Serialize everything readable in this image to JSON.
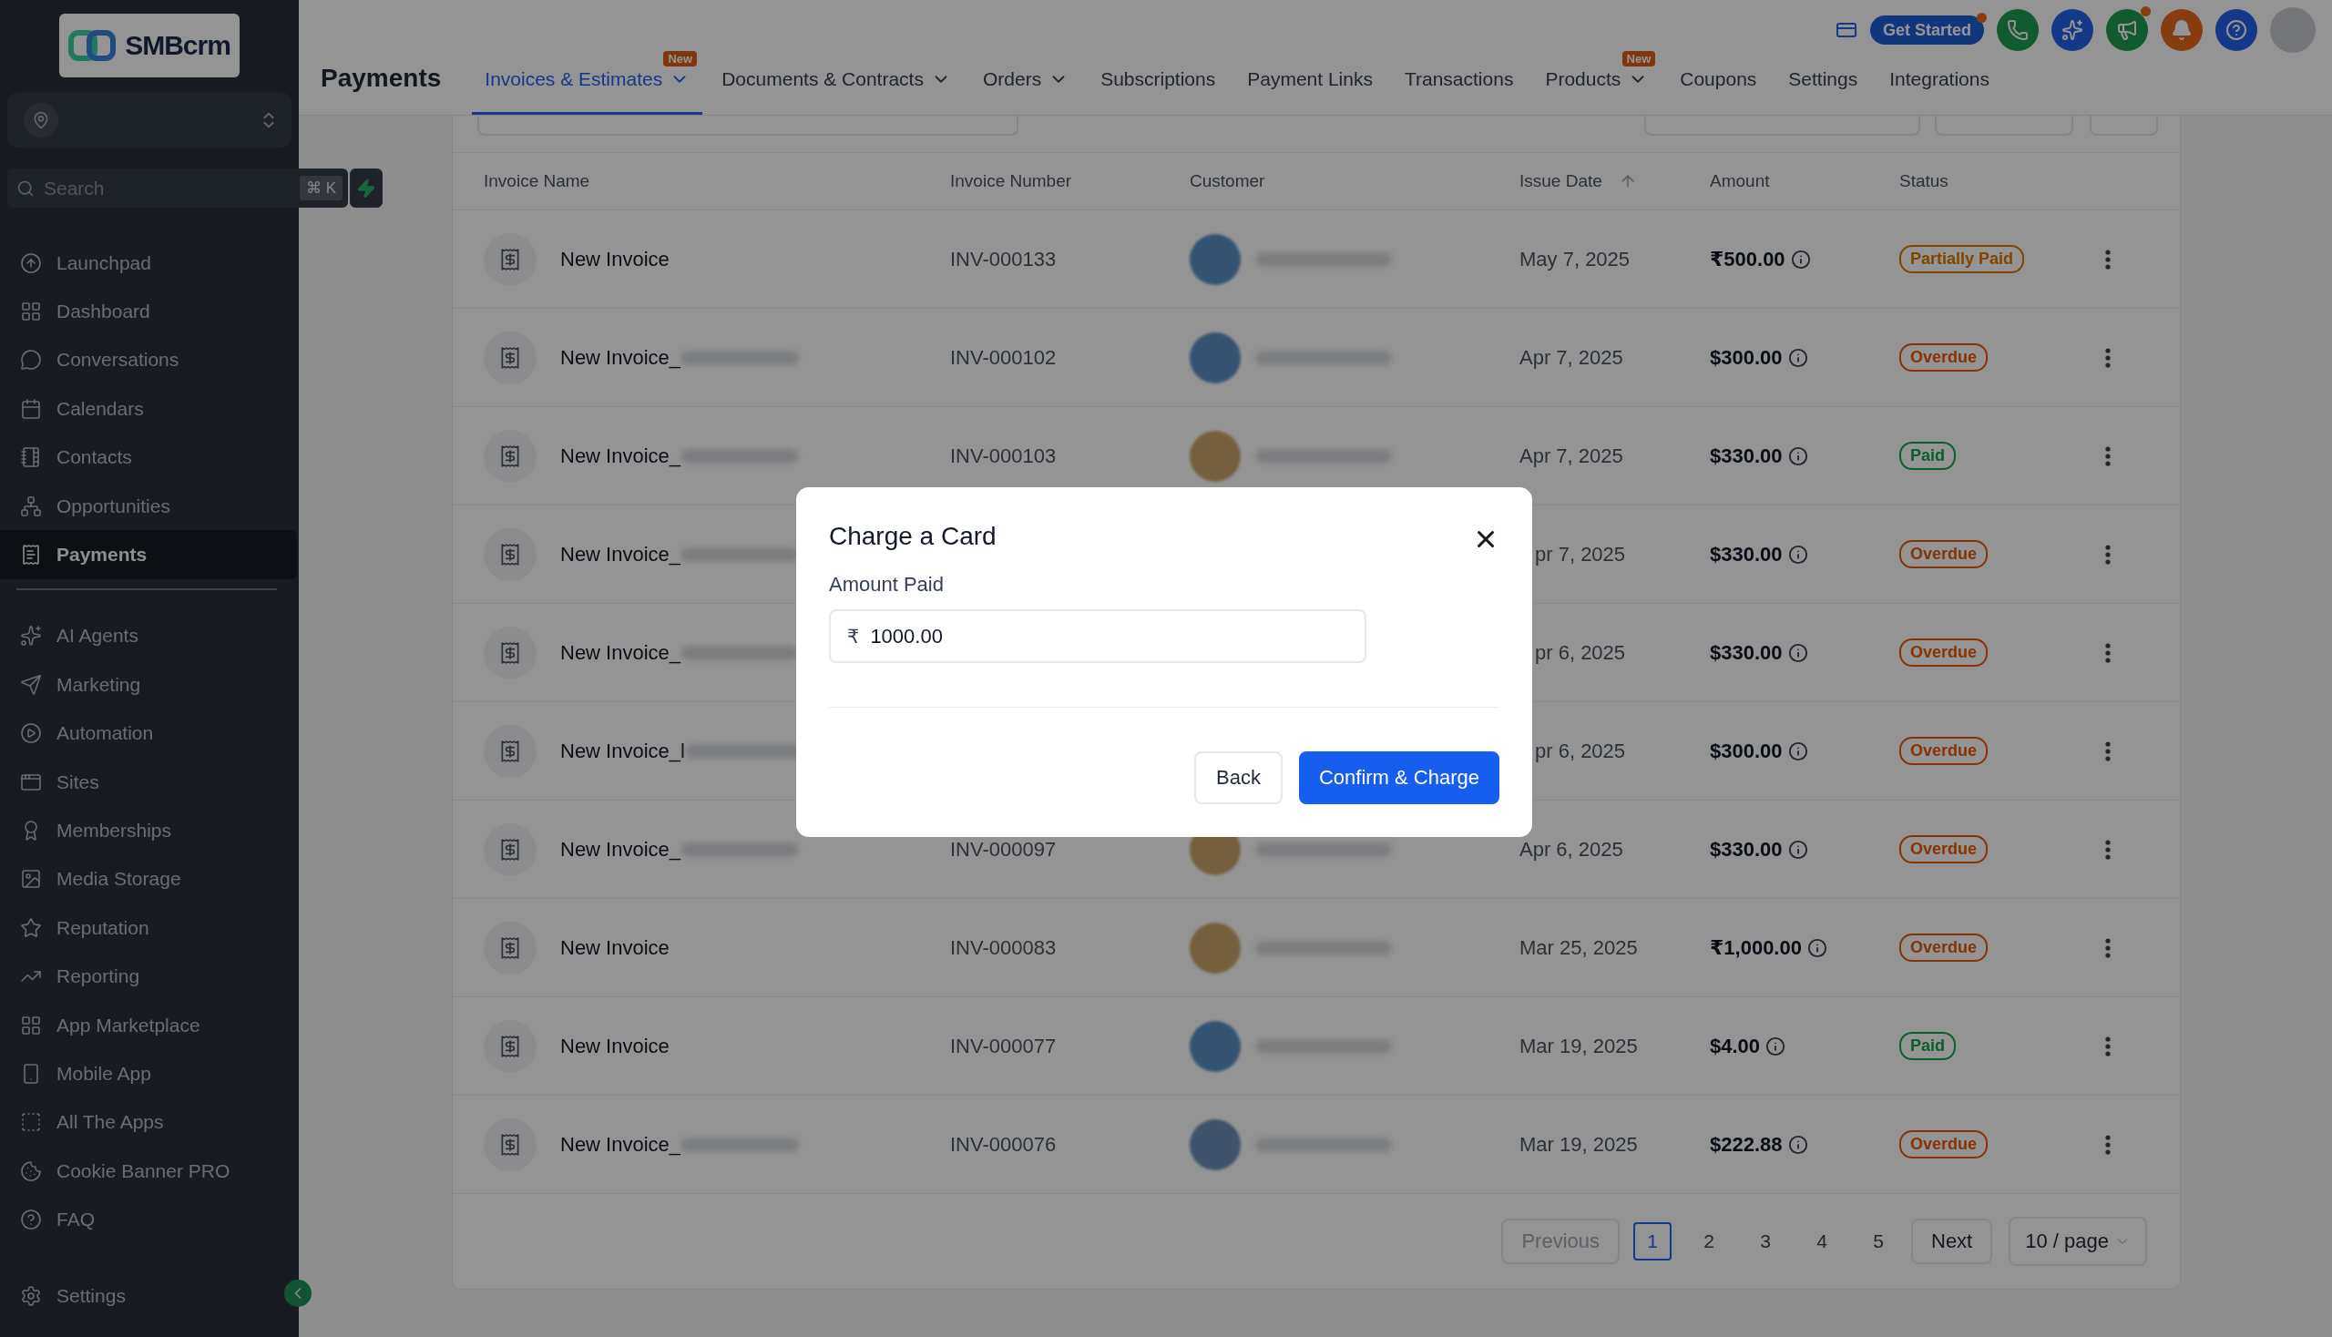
{
  "sidebar": {
    "logo": {
      "text": "SMBcrm"
    },
    "search": {
      "placeholder": "Search",
      "shortcut": "⌘ K"
    },
    "main_items": [
      {
        "label": "Launchpad",
        "selected": false
      },
      {
        "label": "Dashboard",
        "selected": false
      },
      {
        "label": "Conversations",
        "selected": false
      },
      {
        "label": "Calendars",
        "selected": false
      },
      {
        "label": "Contacts",
        "selected": false
      },
      {
        "label": "Opportunities",
        "selected": false
      },
      {
        "label": "Payments",
        "selected": true
      }
    ],
    "more_items": [
      {
        "label": "AI Agents",
        "selected": false
      },
      {
        "label": "Marketing",
        "selected": false
      },
      {
        "label": "Automation",
        "selected": false
      },
      {
        "label": "Sites",
        "selected": false
      },
      {
        "label": "Memberships",
        "selected": false
      },
      {
        "label": "Media Storage",
        "selected": false
      },
      {
        "label": "Reputation",
        "selected": false
      },
      {
        "label": "Reporting",
        "selected": false
      },
      {
        "label": "App Marketplace",
        "selected": false
      },
      {
        "label": "Mobile App",
        "selected": false
      },
      {
        "label": "All The Apps",
        "selected": false
      },
      {
        "label": "Cookie Banner PRO",
        "selected": false
      },
      {
        "label": "FAQ",
        "selected": false
      }
    ],
    "footer_item": {
      "label": "Settings",
      "selected": false
    }
  },
  "header": {
    "title": "Payments",
    "tabs": [
      {
        "label": "Invoices & Estimates",
        "selected": true,
        "dropdown": true,
        "badge": "New"
      },
      {
        "label": "Documents & Contracts",
        "selected": false,
        "dropdown": true
      },
      {
        "label": "Orders",
        "selected": false,
        "dropdown": true
      },
      {
        "label": "Subscriptions",
        "selected": false,
        "dropdown": false
      },
      {
        "label": "Payment Links",
        "selected": false,
        "dropdown": false
      },
      {
        "label": "Transactions",
        "selected": false,
        "dropdown": false
      },
      {
        "label": "Products",
        "selected": false,
        "dropdown": true,
        "badge": "New"
      },
      {
        "label": "Coupons",
        "selected": false,
        "dropdown": false
      },
      {
        "label": "Settings",
        "selected": false,
        "dropdown": false
      },
      {
        "label": "Integrations",
        "selected": false,
        "dropdown": false
      }
    ],
    "get_started": {
      "label": "Get Started",
      "notification": true
    },
    "icon_buttons": [
      {
        "color": "#125b31",
        "notification": false
      },
      {
        "color": "#153988",
        "notification": false
      },
      {
        "color": "#125b31",
        "notification": true
      },
      {
        "color": "#883d10",
        "notification": false
      },
      {
        "color": "#153988",
        "notification": false
      }
    ]
  },
  "table": {
    "columns": [
      "Invoice Name",
      "Invoice Number",
      "Customer",
      "Issue Date",
      "Amount",
      "Status"
    ],
    "rows": [
      {
        "name": "New Invoice",
        "name_redacted": false,
        "covered": false,
        "number": "INV-000133",
        "avatar": {
          "color": "#355373"
        },
        "date": "May 7, 2025",
        "amount": "₹500.00",
        "status": {
          "label": "Partially Paid",
          "color": "#7e4503"
        }
      },
      {
        "name": "New Invoice_",
        "name_redacted": true,
        "covered": false,
        "number": "INV-000102",
        "avatar": {
          "color": "#355373"
        },
        "date": "Apr 7, 2025",
        "amount": "$300.00",
        "status": {
          "label": "Overdue",
          "color": "#883307"
        }
      },
      {
        "name": "New Invoice_",
        "name_redacted": true,
        "covered": false,
        "number": "INV-000103",
        "avatar": {
          "color": "#75603e"
        },
        "date": "Apr 7, 2025",
        "amount": "$330.00",
        "status": {
          "label": "Paid",
          "color": "#0d5f2b"
        }
      },
      {
        "name": "New Invoice_",
        "name_redacted": true,
        "covered": true,
        "date": "pr 7, 2025",
        "amount": "$330.00",
        "status": {
          "label": "Overdue",
          "color": "#883307"
        }
      },
      {
        "name": "New Invoice_",
        "name_redacted": true,
        "covered": true,
        "date": "pr 6, 2025",
        "amount": "$330.00",
        "status": {
          "label": "Overdue",
          "color": "#883307"
        }
      },
      {
        "name": "New Invoice_l",
        "name_redacted": true,
        "covered": true,
        "date": "pr 6, 2025",
        "amount": "$300.00",
        "status": {
          "label": "Overdue",
          "color": "#883307"
        }
      },
      {
        "name": "New Invoice_",
        "name_redacted": true,
        "covered": false,
        "number": "INV-000097",
        "avatar": {
          "color": "#75603e"
        },
        "date": "Apr 6, 2025",
        "amount": "$330.00",
        "status": {
          "label": "Overdue",
          "color": "#883307"
        }
      },
      {
        "name": "New Invoice",
        "name_redacted": false,
        "covered": false,
        "number": "INV-000083",
        "avatar": {
          "color": "#75603e"
        },
        "date": "Mar 25, 2025",
        "amount": "₹1,000.00",
        "status": {
          "label": "Overdue",
          "color": "#883307"
        }
      },
      {
        "name": "New Invoice",
        "name_redacted": false,
        "covered": false,
        "number": "INV-000077",
        "avatar": {
          "color": "#355373"
        },
        "date": "Mar 19, 2025",
        "amount": "$4.00",
        "status": {
          "label": "Paid",
          "color": "#0d5f2b"
        }
      },
      {
        "name": "New Invoice_",
        "name_redacted": true,
        "covered": false,
        "number": "INV-000076",
        "avatar": {
          "color": "#40536b"
        },
        "date": "Mar 19, 2025",
        "amount": "$222.88",
        "status": {
          "label": "Overdue",
          "color": "#883307"
        }
      }
    ]
  },
  "pagination": {
    "previous": {
      "label": "Previous",
      "disabled": true
    },
    "pages": [
      {
        "label": "1",
        "selected": true
      },
      {
        "label": "2",
        "selected": false
      },
      {
        "label": "3",
        "selected": false
      },
      {
        "label": "4",
        "selected": false
      },
      {
        "label": "5",
        "selected": false
      }
    ],
    "next": {
      "label": "Next",
      "disabled": false
    },
    "page_size": "10 / page"
  },
  "modal": {
    "title": "Charge a Card",
    "field_label": "Amount Paid",
    "currency": "₹",
    "value": "1000.00",
    "buttons": [
      {
        "label": "Back",
        "kind": "secondary"
      },
      {
        "label": "Confirm & Charge",
        "kind": "primary"
      }
    ]
  }
}
